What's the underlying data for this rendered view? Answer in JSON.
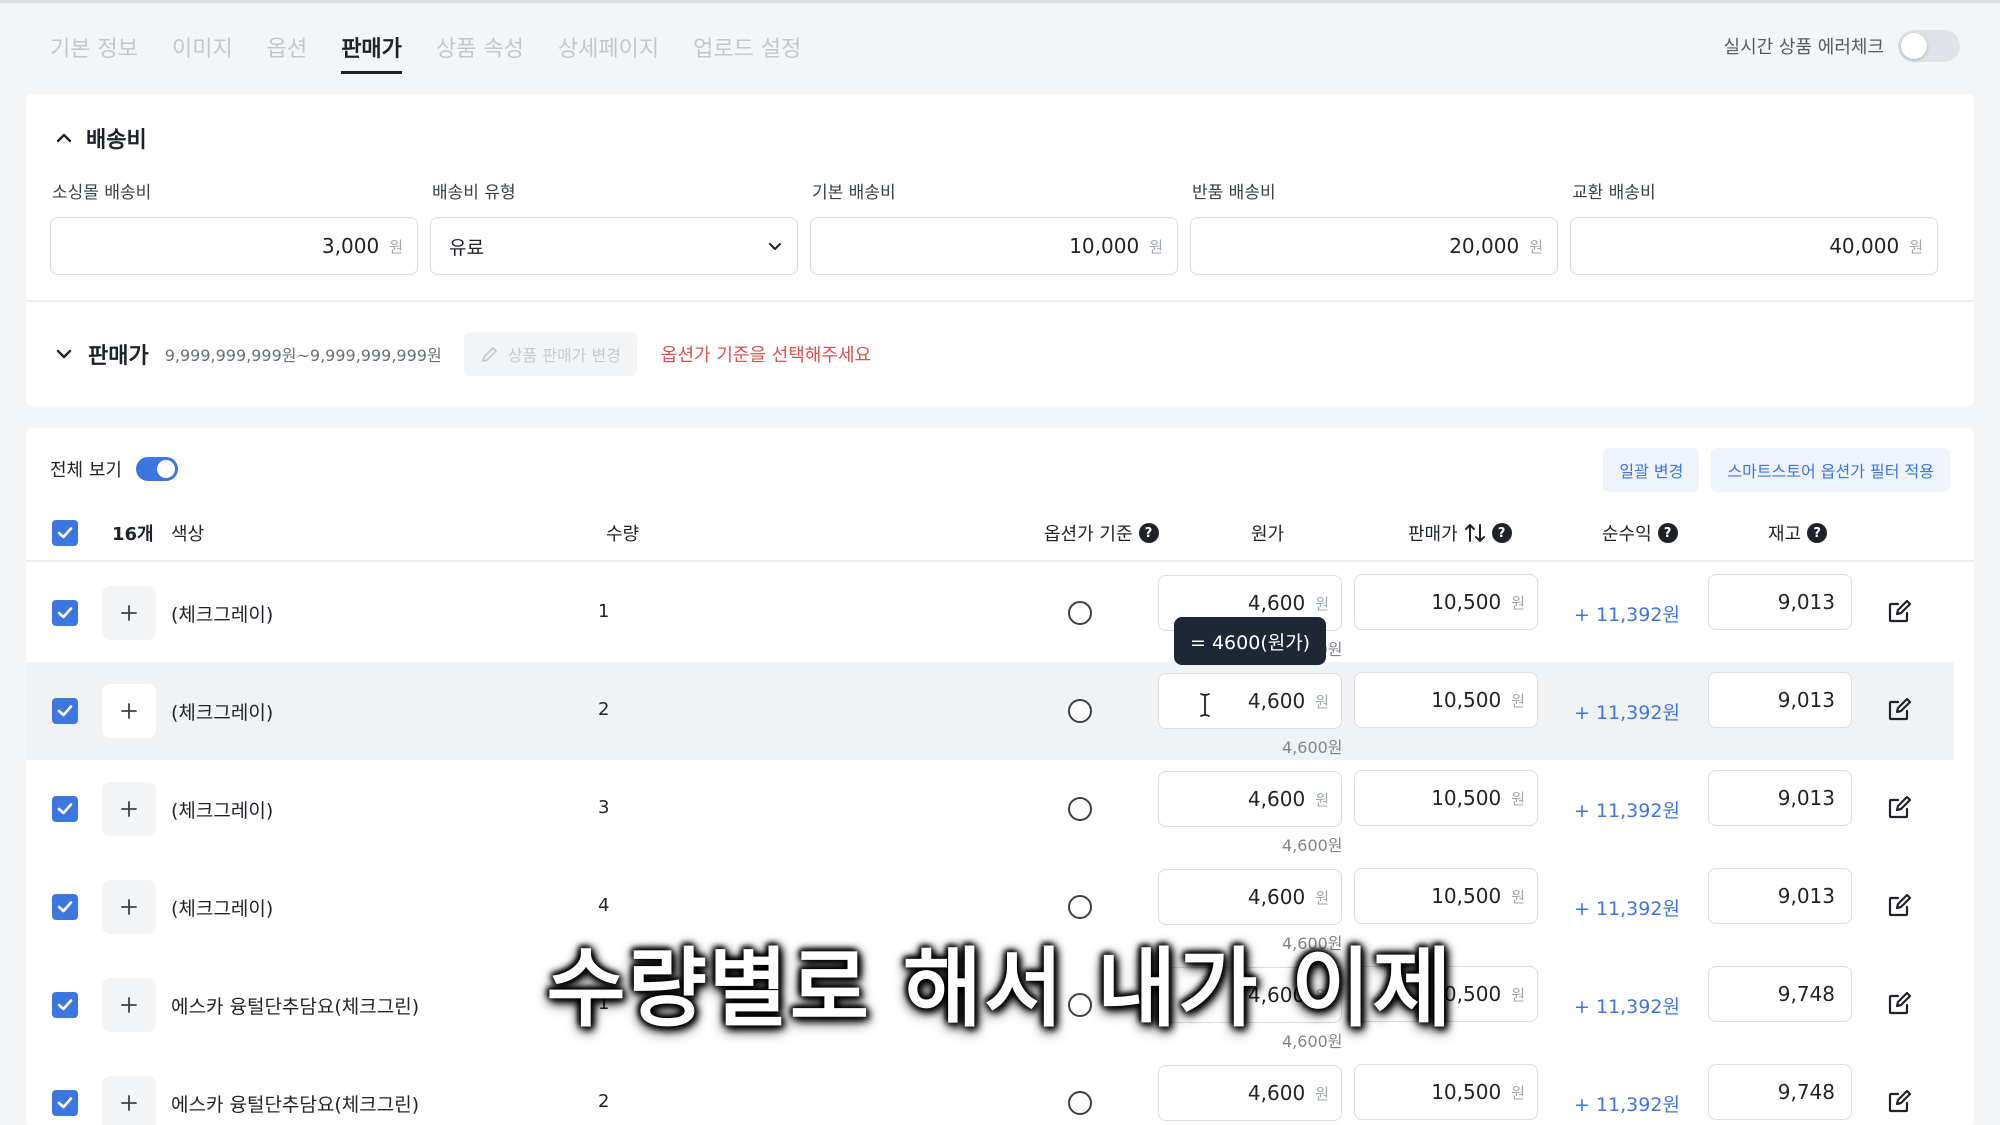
{
  "tabs": [
    {
      "label": "기본 정보",
      "active": false
    },
    {
      "label": "이미지",
      "active": false
    },
    {
      "label": "옵션",
      "active": false
    },
    {
      "label": "판매가",
      "active": true
    },
    {
      "label": "상품 속성",
      "active": false
    },
    {
      "label": "상세페이지",
      "active": false
    },
    {
      "label": "업로드 설정",
      "active": false
    }
  ],
  "error_check": {
    "label": "실시간 상품 에러체크",
    "enabled": false
  },
  "shipping": {
    "title": "배송비",
    "fields": [
      {
        "label": "소싱몰 배송비",
        "value": "3,000",
        "unit": "원"
      },
      {
        "label": "배송비 유형",
        "value": "유료",
        "type": "select"
      },
      {
        "label": "기본 배송비",
        "value": "10,000",
        "unit": "원"
      },
      {
        "label": "반품 배송비",
        "value": "20,000",
        "unit": "원"
      },
      {
        "label": "교환 배송비",
        "value": "40,000",
        "unit": "원"
      }
    ]
  },
  "price_section": {
    "title": "판매가",
    "range": "9,999,999,999원~9,999,999,999원",
    "change_button": "상품 판매가 변경",
    "warning": "옵션가 기준을 선택해주세요"
  },
  "table_toolbar": {
    "view_all_label": "전체 보기",
    "view_all_enabled": true,
    "bulk_change": "일괄 변경",
    "smartstore_filter": "스마트스토어 옵션가 필터 적용"
  },
  "table_header": {
    "count": "16개",
    "color": "색상",
    "qty": "수량",
    "option_base": "옵션가 기준",
    "cost": "원가",
    "sale_price": "판매가",
    "net_profit": "순수익",
    "stock": "재고",
    "help_glyph": "?"
  },
  "unit": "원",
  "rows": [
    {
      "color": "(체크그레이)",
      "qty": "1",
      "cost": "4,600",
      "cost_note": "4,600원",
      "price": "10,500",
      "profit": "+ 11,392원",
      "stock": "9,013"
    },
    {
      "color": "(체크그레이)",
      "qty": "2",
      "cost": "4,600",
      "cost_note": "4,600원",
      "price": "10,500",
      "profit": "+ 11,392원",
      "stock": "9,013"
    },
    {
      "color": "(체크그레이)",
      "qty": "3",
      "cost": "4,600",
      "cost_note": "4,600원",
      "price": "10,500",
      "profit": "+ 11,392원",
      "stock": "9,013"
    },
    {
      "color": "(체크그레이)",
      "qty": "4",
      "cost": "4,600",
      "cost_note": "4,600원",
      "price": "10,500",
      "profit": "+ 11,392원",
      "stock": "9,013"
    },
    {
      "color": "에스카 융털단추담요(체크그린)",
      "qty": "1",
      "cost": "4,600",
      "cost_note": "4,600원",
      "price": "10,500",
      "profit": "+ 11,392원",
      "stock": "9,748"
    },
    {
      "color": "에스카 융털단추담요(체크그린)",
      "qty": "2",
      "cost": "4,600",
      "cost_note": "",
      "price": "10,500",
      "profit": "+ 11,392원",
      "stock": "9,748"
    }
  ],
  "tooltip": "= 4600(원가)",
  "subtitle": "수량별로 해서 내가 이제",
  "colors": {
    "accent": "#3c77e0",
    "warning": "#d9534f",
    "tooltip_bg": "#1e2733"
  }
}
